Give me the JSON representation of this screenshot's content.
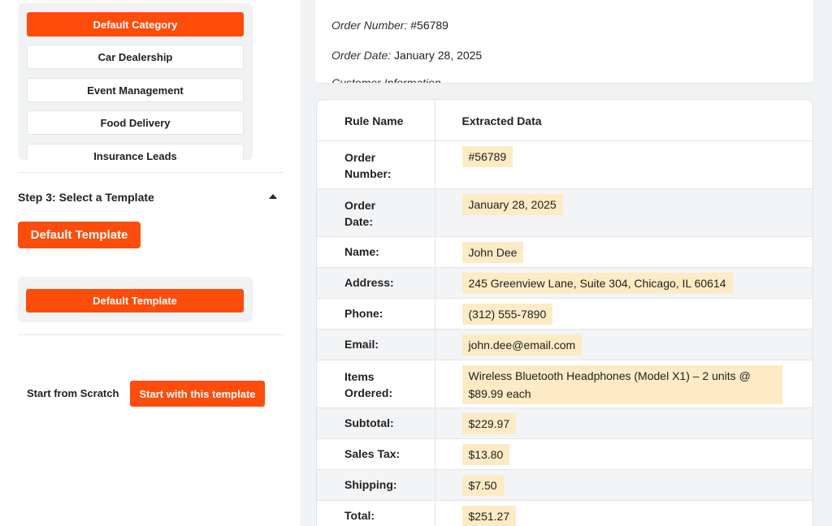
{
  "categories": [
    {
      "label": "Default Category",
      "active": true
    },
    {
      "label": "Car Dealership",
      "active": false
    },
    {
      "label": "Event Management",
      "active": false
    },
    {
      "label": "Food Delivery",
      "active": false
    },
    {
      "label": "Insurance Leads",
      "active": false
    }
  ],
  "step3": {
    "title": "Step 3: Select a Template",
    "template_button": "Default Template",
    "template_item": "Default Template"
  },
  "actions": {
    "scratch_label": "Start from Scratch",
    "start_button": "Start with this template"
  },
  "document": {
    "order_number_label": "Order Number:",
    "order_number_value": " #56789",
    "order_date_label": "Order Date:",
    "order_date_value": " January 28, 2025",
    "customer_info_label": "Customer Information"
  },
  "table": {
    "headers": {
      "rule": "Rule Name",
      "data": "Extracted Data"
    },
    "rows": [
      {
        "rule": "Order Number:",
        "value": "#56789"
      },
      {
        "rule": "Order Date:",
        "value": "January 28, 2025"
      },
      {
        "rule": "Name:",
        "value": "John Dee"
      },
      {
        "rule": "Address:",
        "value": "245 Greenview Lane, Suite 304, Chicago, IL 60614"
      },
      {
        "rule": "Phone:",
        "value": "(312) 555-7890"
      },
      {
        "rule": "Email:",
        "value": "john.dee@email.com"
      },
      {
        "rule": "Items Ordered:",
        "value": "Wireless Bluetooth Headphones (Model X1) – 2 units @ $89.99 each"
      },
      {
        "rule": "Subtotal:",
        "value": "$229.97"
      },
      {
        "rule": "Sales Tax:",
        "value": "$13.80"
      },
      {
        "rule": "Shipping:",
        "value": "$7.50"
      },
      {
        "rule": "Total:",
        "value": "$251.27"
      }
    ]
  },
  "colors": {
    "accent": "#fe4c0b",
    "highlight": "#fcebc4",
    "panel_bg": "#f1f2f4"
  }
}
